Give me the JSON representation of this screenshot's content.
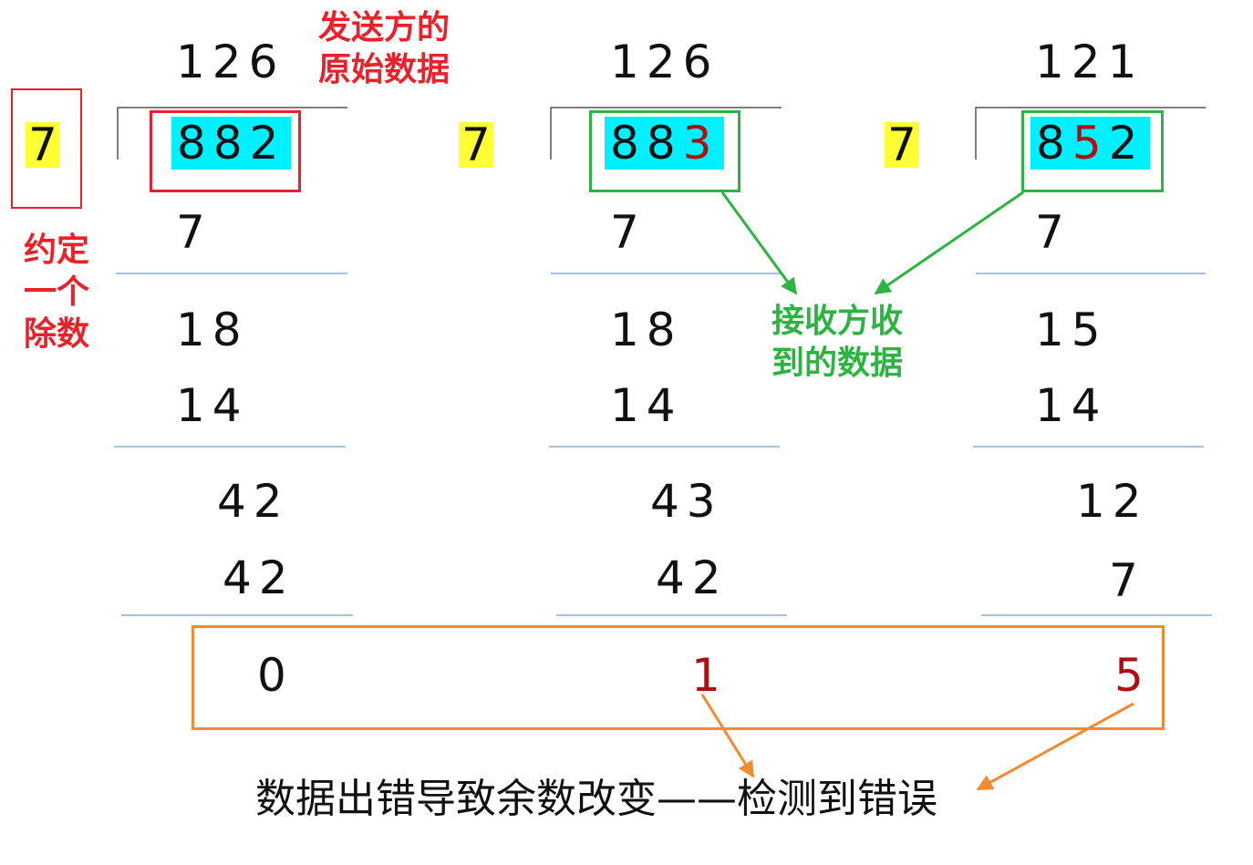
{
  "labels": {
    "sender_data": "发送方的\n原始数据",
    "agreed_divisor": "约定\n一个\n除数",
    "receiver_data": "接收方收\n到的数据",
    "conclusion": "数据出错导致余数改变——检测到错误"
  },
  "divisions": [
    {
      "divisor": "7",
      "quotient": "126",
      "dividend": [
        "8",
        "8",
        "2"
      ],
      "steps": [
        "7",
        "18",
        "14",
        "42",
        "42"
      ],
      "remainder": "0"
    },
    {
      "divisor": "7",
      "quotient": "126",
      "dividend": [
        "8",
        "8",
        "3"
      ],
      "steps": [
        "7",
        "18",
        "14",
        "43",
        "42"
      ],
      "remainder": "1"
    },
    {
      "divisor": "7",
      "quotient": "121",
      "dividend": [
        "8",
        "5",
        "2"
      ],
      "steps": [
        "7",
        "15",
        "14",
        "12",
        "7"
      ],
      "remainder": "5"
    }
  ],
  "colors": {
    "red": "#e8212a",
    "green": "#2db341",
    "orange": "#f28a30",
    "dark_red": "#b00f12",
    "cyan": "#00f0ff",
    "yellow": "#ffff33",
    "rule": "#a9c1dc"
  }
}
